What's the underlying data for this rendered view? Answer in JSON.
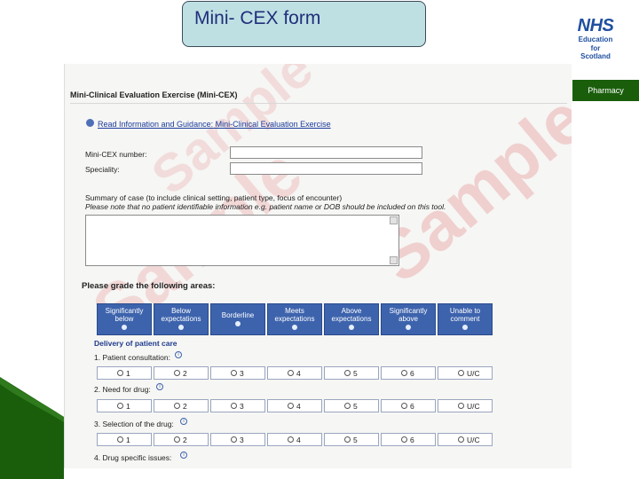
{
  "slide": {
    "title": "Mini- CEX form",
    "logo": {
      "badge": "NHS",
      "lines": [
        "Education",
        "for",
        "Scotland"
      ]
    },
    "band_label": "Pharmacy"
  },
  "colors": {
    "nhs_blue": "#1f4fa0",
    "band_green": "#1a5e0c",
    "header_blue": "#3d63ad",
    "watermark_red": "#e28a8a"
  },
  "form": {
    "heading": "Mini-Clinical Evaluation Exercise (Mini-CEX)",
    "guidance_link": "Read Information and Guidance: Mini-Clinical Evaluation Exercise",
    "number_label": "Mini-CEX number:",
    "speciality_label": "Speciality:",
    "summary_label": "Summary of case (to include clinical setting, patient type, focus of encounter)",
    "privacy_note": "Please note that no patient identifiable information e.g. patient name or DOB should be included on this tool.",
    "grade_heading": "Please grade the following areas:",
    "watermark": "Sample",
    "grade_columns": [
      "Significantly below",
      "Below expectations",
      "Borderline",
      "Meets expectations",
      "Above expectations",
      "Significantly above",
      "Unable to comment"
    ],
    "section": "Delivery of patient care",
    "items": [
      {
        "label": "1. Patient consultation:"
      },
      {
        "label": "2. Need for drug:"
      },
      {
        "label": "3. Selection of the drug:"
      },
      {
        "label": "4. Drug specific issues:"
      }
    ],
    "options": [
      "1",
      "2",
      "3",
      "4",
      "5",
      "6",
      "U/C"
    ]
  }
}
